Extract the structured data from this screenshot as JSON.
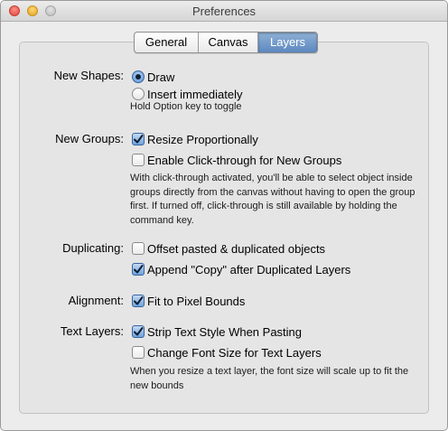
{
  "window": {
    "title": "Preferences"
  },
  "tabs": [
    {
      "label": "General",
      "active": false
    },
    {
      "label": "Canvas",
      "active": false
    },
    {
      "label": "Layers",
      "active": true
    }
  ],
  "new_shapes": {
    "label": "New Shapes:",
    "options": [
      {
        "label": "Draw",
        "selected": true
      },
      {
        "label": "Insert immediately",
        "selected": false
      }
    ],
    "hint": "Hold Option key to toggle"
  },
  "new_groups": {
    "label": "New Groups:",
    "resize": {
      "label": "Resize Proportionally",
      "checked": true
    },
    "click_through": {
      "label": "Enable Click-through for New Groups",
      "checked": false
    },
    "hint": "With click-through activated, you'll be able to select object inside groups directly from the canvas without having to open the group first. If turned off, click-through is still available by holding the command key."
  },
  "duplicating": {
    "label": "Duplicating:",
    "offset": {
      "label": "Offset pasted & duplicated objects",
      "checked": false
    },
    "append_copy": {
      "label": "Append \"Copy\" after Duplicated Layers",
      "checked": true
    }
  },
  "alignment": {
    "label": "Alignment:",
    "fit_pixel": {
      "label": "Fit to Pixel Bounds",
      "checked": true
    }
  },
  "text_layers": {
    "label": "Text Layers:",
    "strip_style": {
      "label": "Strip Text Style When Pasting",
      "checked": true
    },
    "change_font": {
      "label": "Change Font Size for Text Layers",
      "checked": false
    },
    "hint": "When you resize a text layer, the font size will scale up to fit the new bounds"
  }
}
